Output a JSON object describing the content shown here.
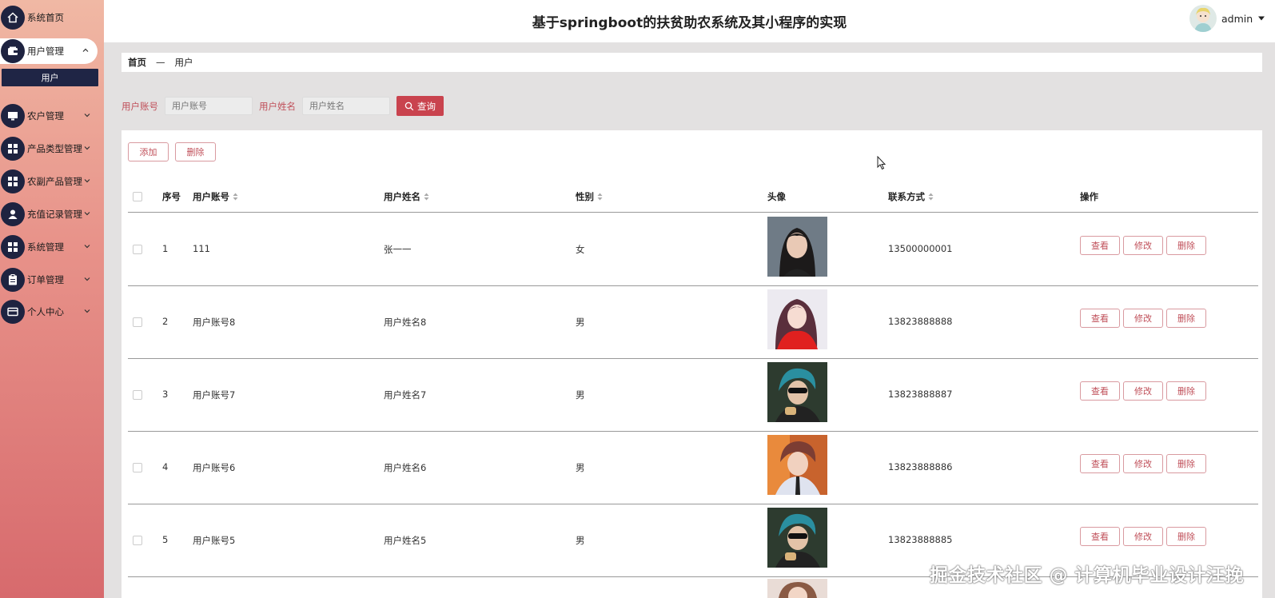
{
  "header": {
    "title": "基于springboot的扶贫助农系统及其小程序的实现",
    "user_name": "admin"
  },
  "sidebar": {
    "items": [
      {
        "label": "系统首页",
        "icon": "home-icon"
      },
      {
        "label": "用户管理",
        "icon": "wallet-icon"
      },
      {
        "label": "农户管理",
        "icon": "monitor-icon"
      },
      {
        "label": "产品类型管理",
        "icon": "grid-icon"
      },
      {
        "label": "农副产品管理",
        "icon": "grid-icon"
      },
      {
        "label": "充值记录管理",
        "icon": "person-icon"
      },
      {
        "label": "系统管理",
        "icon": "grid-icon"
      },
      {
        "label": "订单管理",
        "icon": "clipboard-icon"
      },
      {
        "label": "个人中心",
        "icon": "card-icon"
      }
    ],
    "sub_item": "用户"
  },
  "breadcrumb": {
    "home": "首页",
    "separator": "—",
    "current": "用户"
  },
  "search": {
    "account_label": "用户账号",
    "account_placeholder": "用户账号",
    "name_label": "用户姓名",
    "name_placeholder": "用户姓名",
    "query_button": "查询"
  },
  "toolbar": {
    "add_label": "添加",
    "delete_label": "删除"
  },
  "table": {
    "columns": [
      "序号",
      "用户账号",
      "用户姓名",
      "性别",
      "头像",
      "联系方式",
      "操作"
    ],
    "rows": [
      {
        "index": "1",
        "account": "111",
        "name": "张一一",
        "gender": "女",
        "phone": "13500000001"
      },
      {
        "index": "2",
        "account": "用户账号8",
        "name": "用户姓名8",
        "gender": "男",
        "phone": "13823888888"
      },
      {
        "index": "3",
        "account": "用户账号7",
        "name": "用户姓名7",
        "gender": "男",
        "phone": "13823888887"
      },
      {
        "index": "4",
        "account": "用户账号6",
        "name": "用户姓名6",
        "gender": "男",
        "phone": "13823888886"
      },
      {
        "index": "5",
        "account": "用户账号5",
        "name": "用户姓名5",
        "gender": "男",
        "phone": "13823888885"
      }
    ],
    "actions": {
      "view": "查看",
      "edit": "修改",
      "delete": "删除"
    }
  },
  "watermark": "掘金技术社区 @ 计算机毕业设计汪挽",
  "colors": {
    "accent": "#c9434e",
    "sidebar_dark": "#1f2545"
  }
}
